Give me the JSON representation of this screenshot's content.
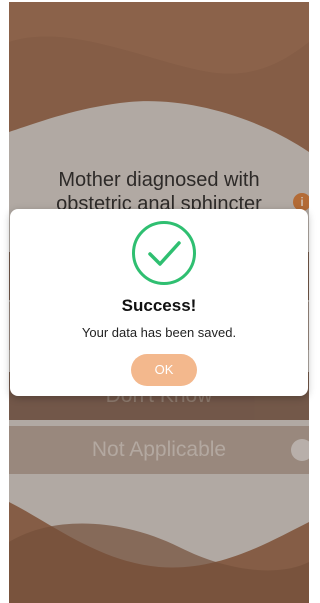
{
  "question": {
    "text_line1": "Mother diagnosed with",
    "text_line2": "obstetric anal sphincter",
    "info_icon": "info-icon"
  },
  "options": [
    {
      "label": ""
    },
    {
      "label": ""
    },
    {
      "label": "Don't Know"
    },
    {
      "label": "Not Applicable"
    }
  ],
  "dialog": {
    "icon": "check-circle-icon",
    "title": "Success!",
    "message": "Your data has been saved.",
    "ok_label": "OK"
  },
  "colors": {
    "brand_brown": "#9a6a4d",
    "accent_green": "#2fbf71",
    "ok_button": "#f3b88d"
  }
}
